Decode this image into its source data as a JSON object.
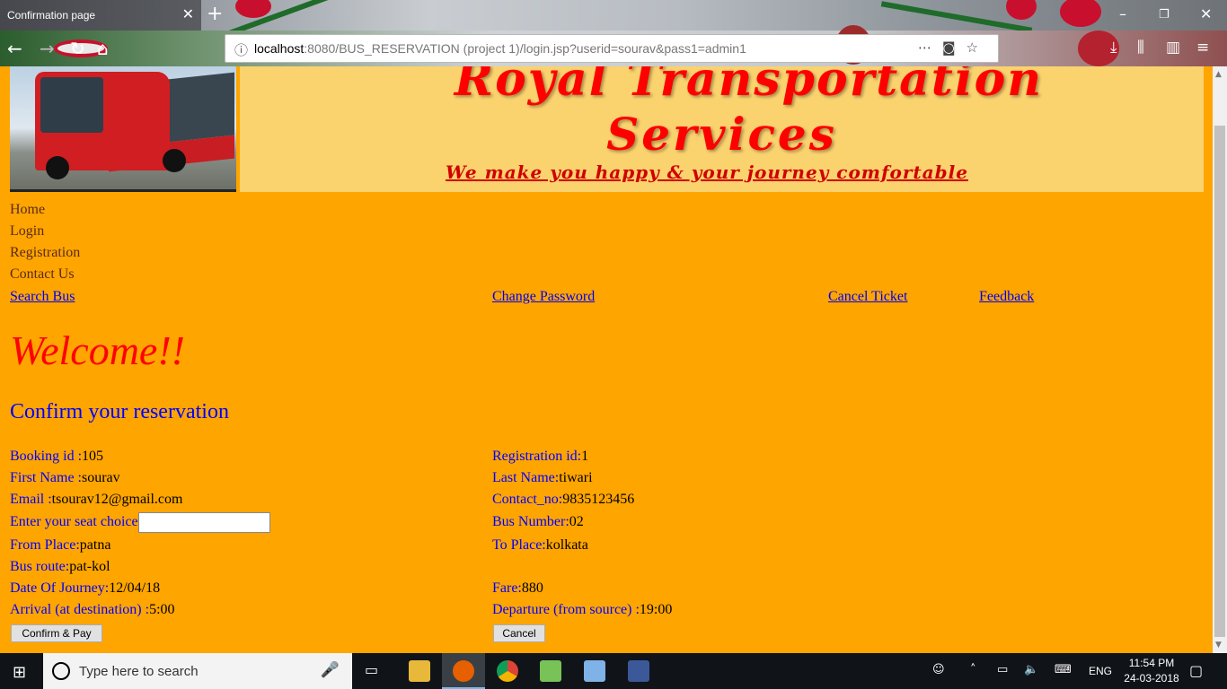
{
  "browser": {
    "tab_title": "Confirmation page",
    "url_host": "localhost",
    "url_rest": ":8080/BUS_RESERVATION (project 1)/login.jsp?userid=sourav&pass1=admin1"
  },
  "banner": {
    "title_line1": "Royal Transportation",
    "title_line2": "Services",
    "tagline": "We make you happy & your journey comfortable"
  },
  "menu": [
    "Home",
    "Login",
    "Registration",
    "Contact Us"
  ],
  "links": {
    "search_bus": "Search Bus",
    "change_password": "Change Password",
    "cancel_ticket": "Cancel Ticket",
    "feedback": "Feedback"
  },
  "welcome": "Welcome!!",
  "confirm_heading": "Confirm your reservation",
  "fields": {
    "booking_id": {
      "label": "Booking id :",
      "value": "105"
    },
    "registration_id": {
      "label": "Registration id:",
      "value": "1"
    },
    "first_name": {
      "label": "First Name :",
      "value": "sourav"
    },
    "last_name": {
      "label": "Last Name:",
      "value": "tiwari"
    },
    "email": {
      "label": "Email :",
      "value": "tsourav12@gmail.com"
    },
    "contact_no": {
      "label": "Contact_no:",
      "value": "9835123456"
    },
    "seat_choice": {
      "label": "Enter your seat choice",
      "value": ""
    },
    "bus_number": {
      "label": "Bus Number:",
      "value": "02"
    },
    "from_place": {
      "label": "From Place:",
      "value": "patna"
    },
    "to_place": {
      "label": "To Place:",
      "value": "kolkata"
    },
    "bus_route": {
      "label": "Bus route:",
      "value": "pat-kol"
    },
    "date_of_journey": {
      "label": "Date Of Journey:",
      "value": "12/04/18"
    },
    "fare": {
      "label": "Fare:",
      "value": "880"
    },
    "arrival": {
      "label": "Arrival (at destination) :",
      "value": "5:00"
    },
    "departure": {
      "label": "Departure (from source) :",
      "value": "19:00"
    }
  },
  "buttons": {
    "confirm_pay": "Confirm & Pay",
    "cancel": "Cancel"
  },
  "taskbar": {
    "search_placeholder": "Type here to search",
    "language": "ENG",
    "time": "11:54 PM",
    "date": "24-03-2018"
  }
}
